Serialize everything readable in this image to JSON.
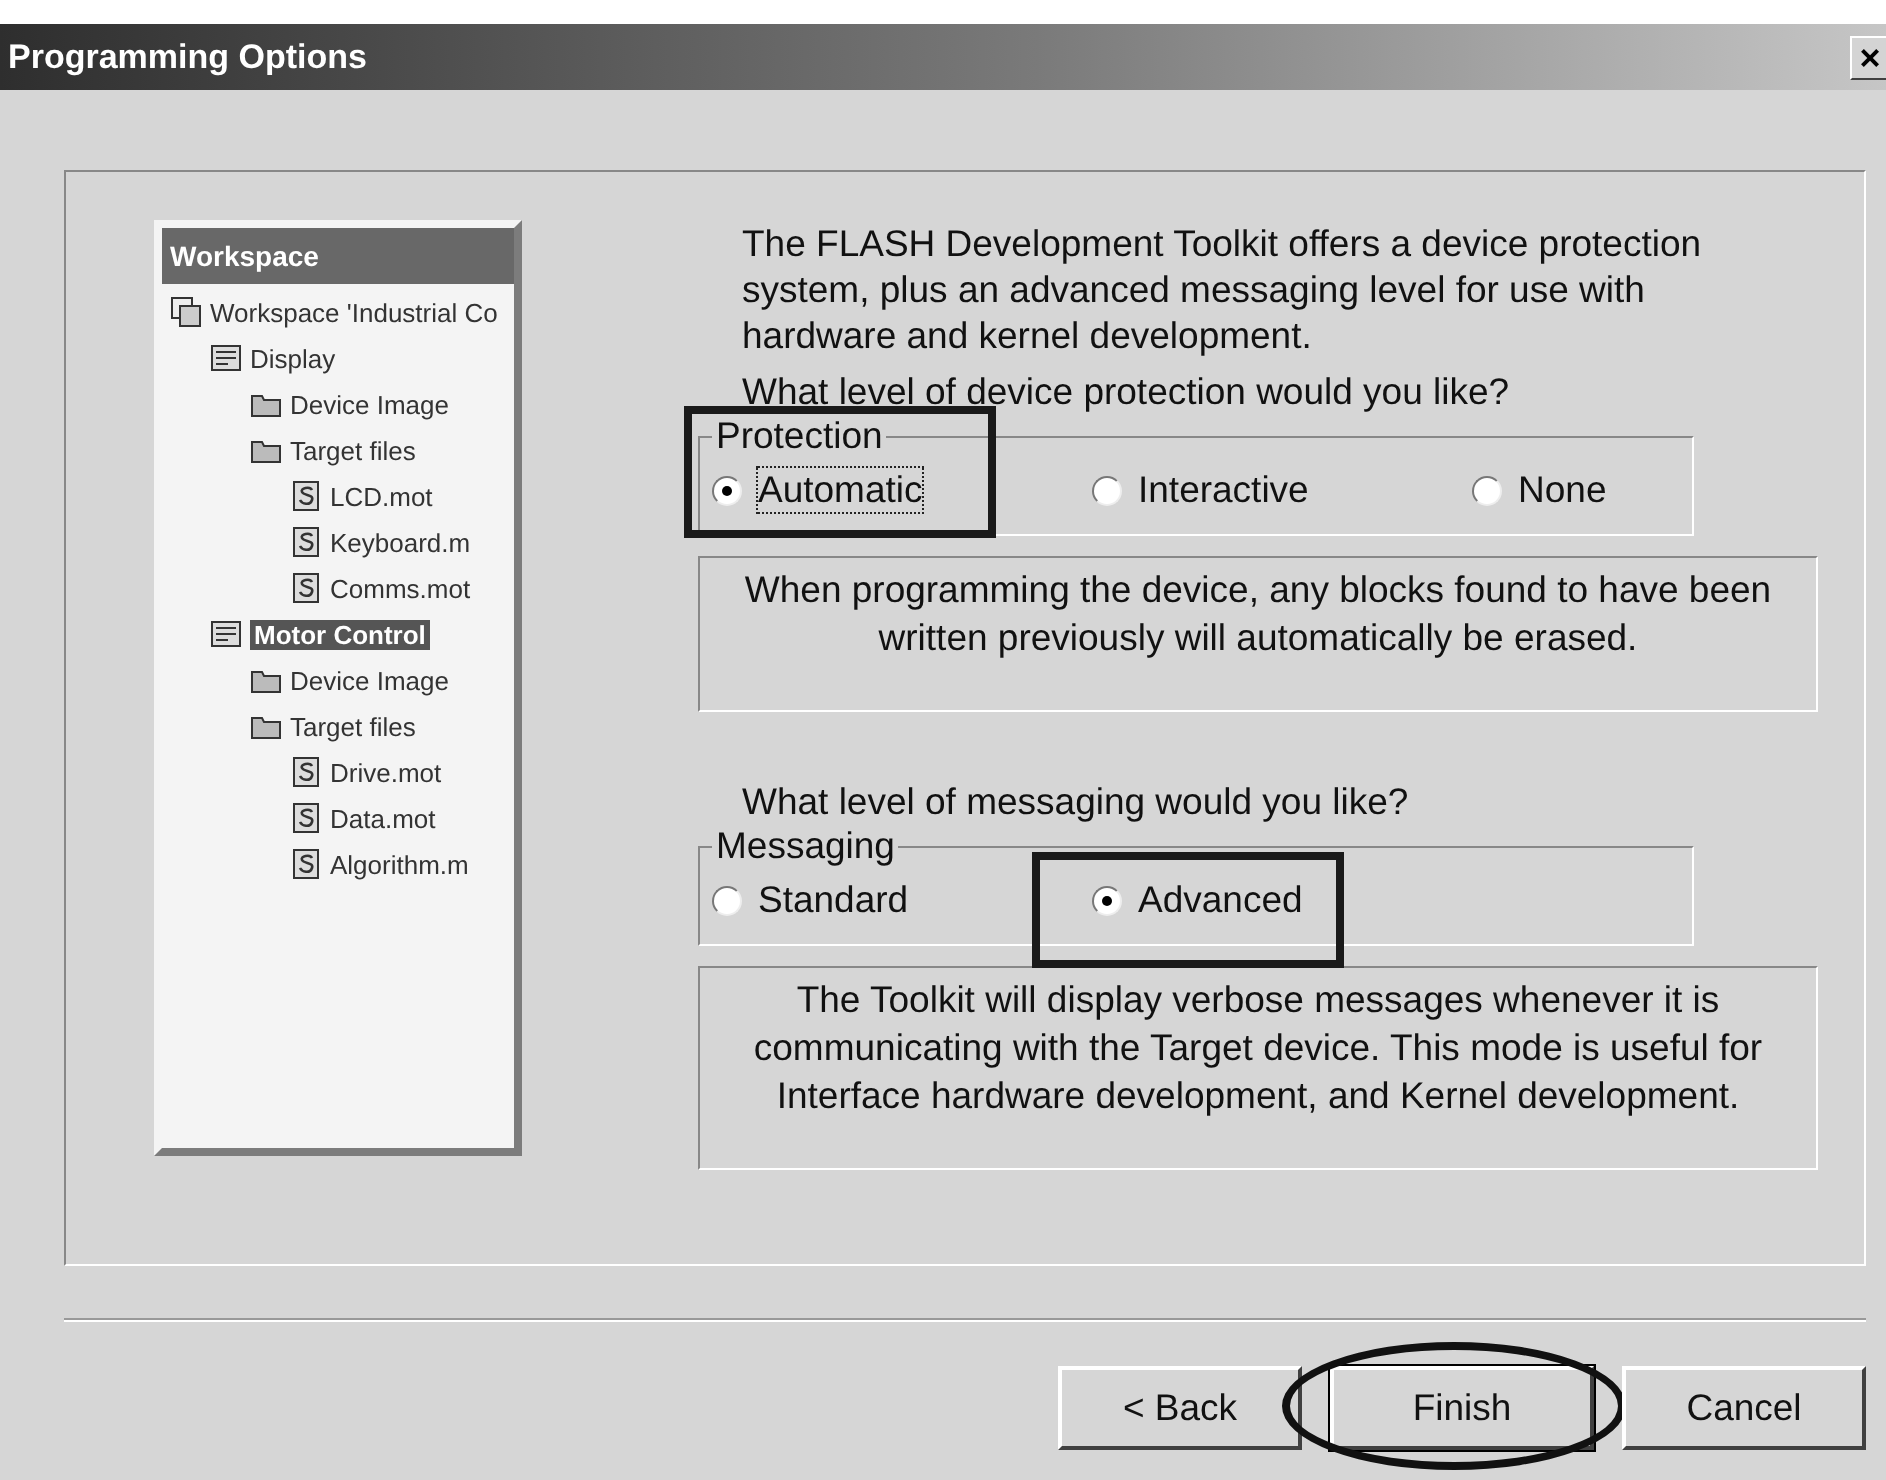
{
  "window": {
    "title": "Programming Options",
    "close": "×"
  },
  "illustration": {
    "header": "Workspace",
    "tree": [
      {
        "label": "Workspace 'Industrial Co",
        "kind": "workspace",
        "selected": false,
        "children": [
          {
            "label": "Display",
            "kind": "project",
            "selected": false,
            "children": [
              {
                "label": "Device Image",
                "kind": "folder",
                "selected": false
              },
              {
                "label": "Target files",
                "kind": "folder",
                "selected": false,
                "children": [
                  {
                    "label": "LCD.mot",
                    "kind": "file",
                    "selected": false
                  },
                  {
                    "label": "Keyboard.m",
                    "kind": "file",
                    "selected": false
                  },
                  {
                    "label": "Comms.mot",
                    "kind": "file",
                    "selected": false
                  }
                ]
              }
            ]
          },
          {
            "label": "Motor Control",
            "kind": "project",
            "selected": true,
            "children": [
              {
                "label": "Device Image",
                "kind": "folder",
                "selected": false
              },
              {
                "label": "Target files",
                "kind": "folder",
                "selected": false,
                "children": [
                  {
                    "label": "Drive.mot",
                    "kind": "file",
                    "selected": false
                  },
                  {
                    "label": "Data.mot",
                    "kind": "file",
                    "selected": false
                  },
                  {
                    "label": "Algorithm.m",
                    "kind": "file",
                    "selected": false
                  }
                ]
              }
            ]
          }
        ]
      }
    ]
  },
  "intro": "The FLASH Development Toolkit offers a device protection system, plus an advanced messaging level for use with hardware and kernel development.",
  "sections": [
    {
      "question": "What level of device protection would you like?",
      "group": "Protection",
      "options": [
        {
          "label": "Automatic",
          "selected": true,
          "focused": true,
          "highlighted": true
        },
        {
          "label": "Interactive",
          "selected": false,
          "focused": false,
          "highlighted": false
        },
        {
          "label": "None",
          "selected": false,
          "focused": false,
          "highlighted": false
        }
      ],
      "description": "When programming the device, any blocks found to have been written previously will automatically be erased."
    },
    {
      "question": "What level of messaging would you like?",
      "group": "Messaging",
      "options": [
        {
          "label": "Standard",
          "selected": false,
          "focused": false,
          "highlighted": false
        },
        {
          "label": "Advanced",
          "selected": true,
          "focused": false,
          "highlighted": true
        }
      ],
      "description": "The Toolkit will display verbose messages whenever it is communicating with the Target device. This mode is useful for Interface hardware development, and Kernel development."
    }
  ],
  "buttons": [
    {
      "label": "< Back",
      "default": false,
      "highlighted": false
    },
    {
      "label": "Finish",
      "default": true,
      "highlighted": true
    },
    {
      "label": "Cancel",
      "default": false,
      "highlighted": false
    }
  ]
}
